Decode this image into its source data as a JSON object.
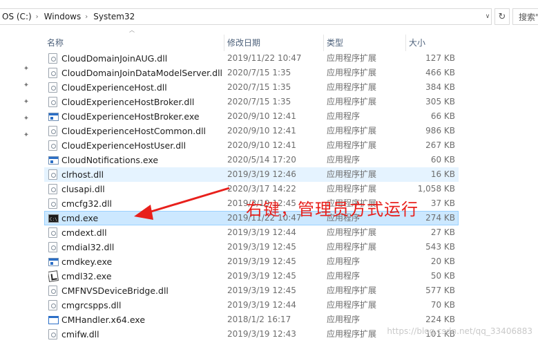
{
  "addressbar": {
    "crumbs": [
      "OS (C:)",
      "Windows",
      "System32"
    ],
    "search_placeholder": "搜索\"S"
  },
  "columns": {
    "name": "名称",
    "date": "修改日期",
    "type": "类型",
    "size": "大小"
  },
  "files": [
    {
      "name": "CloudDomainJoinAUG.dll",
      "date": "2019/11/22 10:47",
      "type": "应用程序扩展",
      "size": "127 KB",
      "icon": "dll-icon",
      "state": ""
    },
    {
      "name": "CloudDomainJoinDataModelServer.dll",
      "date": "2020/7/15 1:35",
      "type": "应用程序扩展",
      "size": "466 KB",
      "icon": "dll-icon",
      "state": ""
    },
    {
      "name": "CloudExperienceHost.dll",
      "date": "2020/7/15 1:35",
      "type": "应用程序扩展",
      "size": "384 KB",
      "icon": "dll-icon",
      "state": ""
    },
    {
      "name": "CloudExperienceHostBroker.dll",
      "date": "2020/7/15 1:35",
      "type": "应用程序扩展",
      "size": "305 KB",
      "icon": "dll-icon",
      "state": ""
    },
    {
      "name": "CloudExperienceHostBroker.exe",
      "date": "2020/9/10 12:41",
      "type": "应用程序",
      "size": "66 KB",
      "icon": "exe-icon",
      "state": ""
    },
    {
      "name": "CloudExperienceHostCommon.dll",
      "date": "2020/9/10 12:41",
      "type": "应用程序扩展",
      "size": "986 KB",
      "icon": "dll-icon",
      "state": ""
    },
    {
      "name": "CloudExperienceHostUser.dll",
      "date": "2020/9/10 12:41",
      "type": "应用程序扩展",
      "size": "267 KB",
      "icon": "dll-icon",
      "state": ""
    },
    {
      "name": "CloudNotifications.exe",
      "date": "2020/5/14 17:20",
      "type": "应用程序",
      "size": "60 KB",
      "icon": "exe-icon",
      "state": ""
    },
    {
      "name": "clrhost.dll",
      "date": "2019/3/19 12:46",
      "type": "应用程序扩展",
      "size": "16 KB",
      "icon": "dll-icon",
      "state": "hover"
    },
    {
      "name": "clusapi.dll",
      "date": "2020/3/17 14:22",
      "type": "应用程序扩展",
      "size": "1,058 KB",
      "icon": "dll-icon",
      "state": ""
    },
    {
      "name": "cmcfg32.dll",
      "date": "2019/3/19 12:45",
      "type": "应用程序扩展",
      "size": "37 KB",
      "icon": "dll-icon",
      "state": ""
    },
    {
      "name": "cmd.exe",
      "date": "2019/11/22 10:47",
      "type": "应用程序",
      "size": "274 KB",
      "icon": "cmd-icon",
      "state": "sel"
    },
    {
      "name": "cmdext.dll",
      "date": "2019/3/19 12:44",
      "type": "应用程序扩展",
      "size": "27 KB",
      "icon": "dll-icon",
      "state": ""
    },
    {
      "name": "cmdial32.dll",
      "date": "2019/3/19 12:45",
      "type": "应用程序扩展",
      "size": "543 KB",
      "icon": "dll-icon",
      "state": ""
    },
    {
      "name": "cmdkey.exe",
      "date": "2019/3/19 12:45",
      "type": "应用程序",
      "size": "20 KB",
      "icon": "exe-icon",
      "state": ""
    },
    {
      "name": "cmdl32.exe",
      "date": "2019/3/19 12:45",
      "type": "应用程序",
      "size": "50 KB",
      "icon": "cmdl-icon",
      "state": ""
    },
    {
      "name": "CMFNVSDeviceBridge.dll",
      "date": "2019/3/19 12:45",
      "type": "应用程序扩展",
      "size": "577 KB",
      "icon": "dll-icon",
      "state": ""
    },
    {
      "name": "cmgrcspps.dll",
      "date": "2019/3/19 12:44",
      "type": "应用程序扩展",
      "size": "70 KB",
      "icon": "dll-icon",
      "state": ""
    },
    {
      "name": "CMHandler.x64.exe",
      "date": "2018/1/2 16:17",
      "type": "应用程序",
      "size": "224 KB",
      "icon": "app-icon",
      "state": ""
    },
    {
      "name": "cmifw.dll",
      "date": "2019/3/19 12:43",
      "type": "应用程序扩展",
      "size": "101 KB",
      "icon": "dll-icon",
      "state": ""
    }
  ],
  "annotation": {
    "text": "右键，管理员方式运行",
    "color": "#e8201c"
  },
  "watermark": "https://blog.csdn.net/qq_33406883",
  "colors": {
    "selected_row": "#cce8ff",
    "hover_row": "#e5f3ff",
    "header_text": "#4c607a"
  }
}
